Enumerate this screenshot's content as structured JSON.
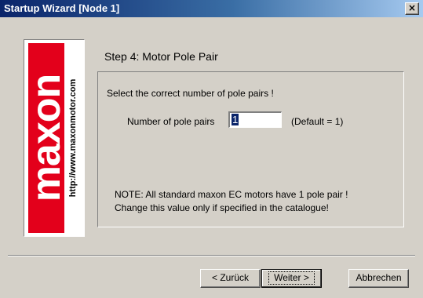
{
  "window": {
    "title": "Startup Wizard  [Node 1]",
    "close_glyph": "✕"
  },
  "logo": {
    "brand": "maxon",
    "url": "http://www.maxonmotor.com",
    "brand_color": "#e3001b"
  },
  "step": {
    "title": "Step 4: Motor Pole Pair"
  },
  "group": {
    "instruction": "Select the correct number of pole pairs !",
    "pole_pairs_label": "Number of pole pairs",
    "pole_pairs_value": "1",
    "default_text": "(Default = 1)",
    "note_line1": "NOTE: All standard maxon EC motors have 1 pole pair !",
    "note_line2": "Change this value only if specified in the catalogue!"
  },
  "buttons": {
    "back_label": "< Zurück",
    "next_label": "Weiter >",
    "cancel_label": "Abbrechen"
  }
}
